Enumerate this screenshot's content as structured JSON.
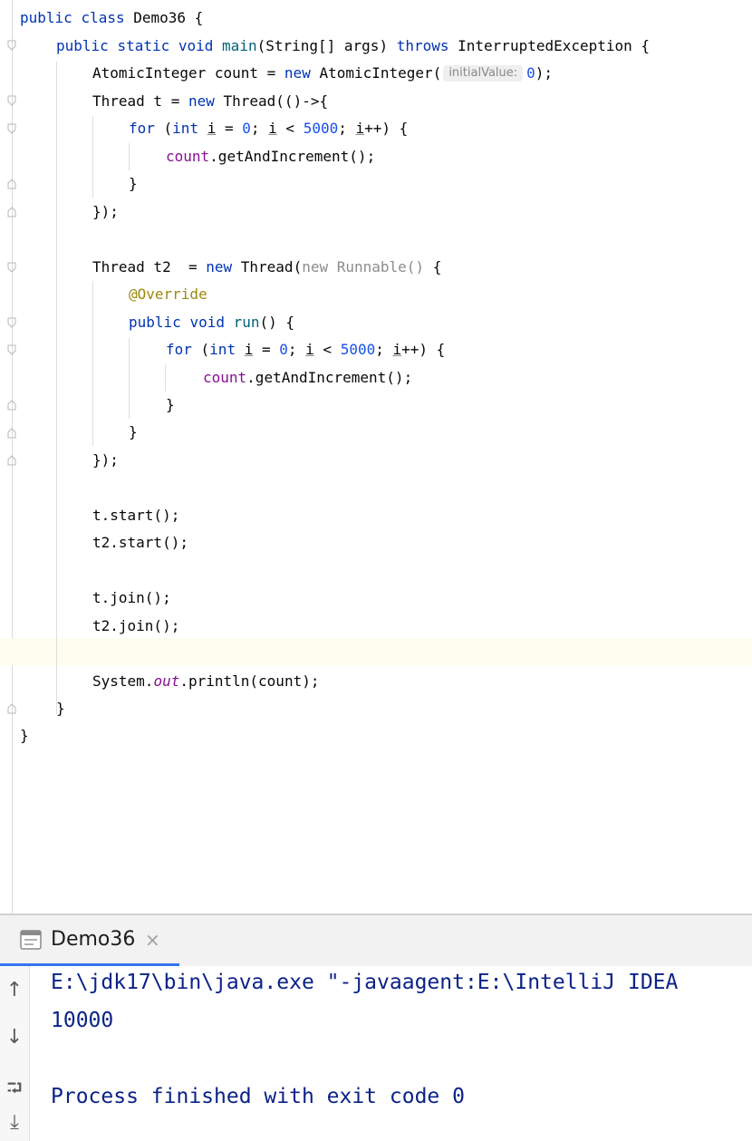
{
  "editor": {
    "hint_label": "initialValue:",
    "code": {
      "l1": {
        "a": "public ",
        "b": "class ",
        "c": "Demo36 {"
      },
      "l2": {
        "a": "public ",
        "b": "static ",
        "c": "void ",
        "d": "main",
        "e": "(String[] args) ",
        "f": "throws ",
        "g": "InterruptedException {"
      },
      "l3": {
        "a": "AtomicInteger count = ",
        "b": "new ",
        "c": "AtomicInteger(",
        "d": "0",
        "e": ");"
      },
      "l4": {
        "a": "Thread t = ",
        "b": "new ",
        "c": "Thread(()->{"
      },
      "l5": {
        "a": "for ",
        "b": "(",
        "c": "int ",
        "d": "i",
        "e": " = ",
        "f": "0",
        "g": "; ",
        "h": "i",
        "i": " < ",
        "j": "5000",
        "k": "; ",
        "l": "i",
        "m": "++) {"
      },
      "l6": {
        "a": "count",
        "b": ".getAndIncrement();"
      },
      "l7": {
        "a": "}"
      },
      "l8": {
        "a": "});"
      },
      "l10": {
        "a": "Thread t2  = ",
        "b": "new ",
        "c": "Thread(",
        "d": "new ",
        "e": "Runnable() ",
        "f": "{"
      },
      "l11": {
        "a": "@Override"
      },
      "l12": {
        "a": "public ",
        "b": "void ",
        "c": "run",
        "d": "() {"
      },
      "l13": {
        "a": "for ",
        "b": "(",
        "c": "int ",
        "d": "i",
        "e": " = ",
        "f": "0",
        "g": "; ",
        "h": "i",
        "i": " < ",
        "j": "5000",
        "k": "; ",
        "l": "i",
        "m": "++) {"
      },
      "l14": {
        "a": "count",
        "b": ".getAndIncrement();"
      },
      "l15": {
        "a": "}"
      },
      "l16": {
        "a": "}"
      },
      "l17": {
        "a": "});"
      },
      "l19": {
        "a": "t.start();"
      },
      "l20": {
        "a": "t2.start();"
      },
      "l22": {
        "a": "t.join();"
      },
      "l23": {
        "a": "t2.join();"
      },
      "l25": {
        "a": "System.",
        "b": "out",
        "c": ".println(count);"
      },
      "l26": {
        "a": "}"
      },
      "l27": {
        "a": "}"
      }
    }
  },
  "run_panel": {
    "tab_label": "Demo36",
    "tab_close": "×",
    "toolbar": {
      "up": "↑",
      "down": "↓",
      "wrap": "⮒",
      "scroll_end": "⤓"
    },
    "output": {
      "command": "E:\\jdk17\\bin\\java.exe \"-javaagent:E:\\IntelliJ IDEA",
      "result": "10000",
      "finished": "Process finished with exit code 0"
    }
  },
  "colors": {
    "keyword": "#0033b3",
    "number": "#1750eb",
    "field": "#871094",
    "method": "#00627a",
    "annotation": "#9e880d",
    "console": "#0b2288",
    "tab_underline": "#3574f0"
  }
}
